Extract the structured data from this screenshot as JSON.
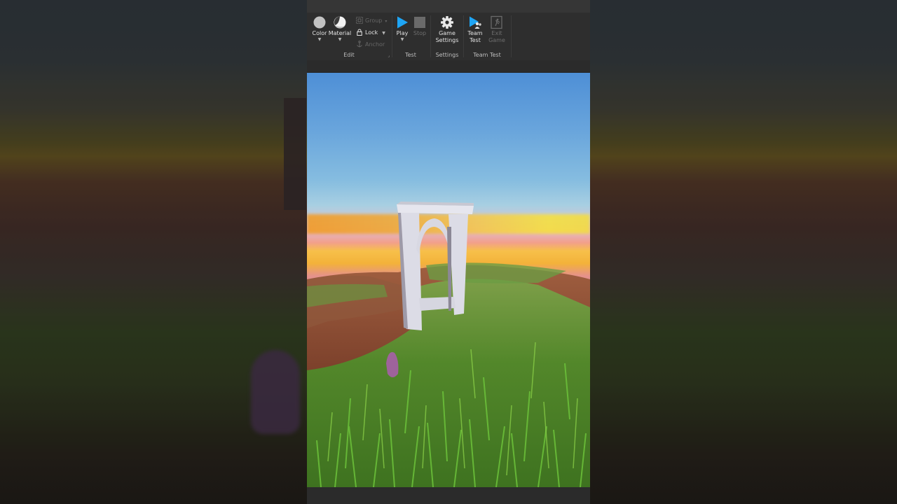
{
  "ribbon": {
    "edit": {
      "label": "Edit",
      "color_label": "Color",
      "material_label": "Material",
      "group_label": "Group",
      "lock_label": "Lock",
      "anchor_label": "Anchor"
    },
    "test": {
      "label": "Test",
      "play_label": "Play",
      "stop_label": "Stop"
    },
    "settings": {
      "label": "Settings",
      "game_settings_line1": "Game",
      "game_settings_line2": "Settings"
    },
    "team_test": {
      "label": "Team Test",
      "team_test_line1": "Team",
      "team_test_line2": "Test",
      "exit_game_line1": "Exit",
      "exit_game_line2": "Game"
    }
  },
  "icons": {
    "color": "circle-icon",
    "material": "material-sphere-icon",
    "group": "group-icon",
    "lock": "lock-icon",
    "anchor": "anchor-icon",
    "play": "play-icon",
    "stop": "stop-icon",
    "game_settings": "gear-icon",
    "team_test": "team-test-icon",
    "exit_game": "exit-game-icon"
  },
  "colors": {
    "ribbon_bg": "#2e2e2e",
    "play_accent": "#1ea5f5",
    "text": "#e4e4e4",
    "disabled_text": "#6e6e6e",
    "sky_top": "#4e8fd6",
    "sunset": "#f5c84a",
    "grass": "#4f9a2a",
    "arch": "#dcdce6"
  }
}
